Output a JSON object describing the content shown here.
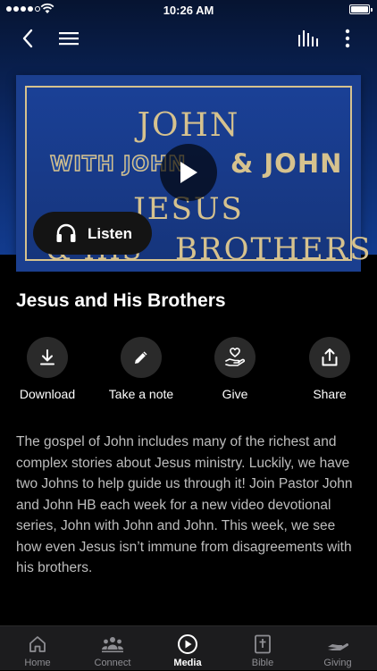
{
  "status_bar": {
    "time": "10:26 AM",
    "signal_icon": "signal-dots-icon",
    "wifi_icon": "wifi-icon",
    "battery_icon": "battery-full-icon"
  },
  "nav": {
    "back_icon": "chevron-left-icon",
    "menu_icon": "hamburger-menu-icon",
    "bars_icon": "equalizer-bars-icon",
    "more_icon": "more-vertical-icon"
  },
  "artwork": {
    "line1": "JOHN",
    "line2a": "WITH JOHN",
    "line2b": "& JOHN",
    "line3": "JESUS",
    "line4a": "& HIS",
    "line4b": "BROTHERS",
    "colors": {
      "gold": "#d6c28e",
      "blue": "#1a4096"
    }
  },
  "listen_button": {
    "label": "Listen",
    "icon": "headphones-icon"
  },
  "play_button": {
    "icon": "play-icon"
  },
  "media_title": "Jesus and His Brothers",
  "actions": [
    {
      "label": "Download",
      "icon": "download-icon"
    },
    {
      "label": "Take a note",
      "icon": "pencil-icon"
    },
    {
      "label": "Give",
      "icon": "hand-heart-icon"
    },
    {
      "label": "Share",
      "icon": "share-icon"
    }
  ],
  "description": "The gospel of John includes many of the richest and complex stories about Jesus ministry. Luckily, we have two Johns to help guide us through it! Join Pastor John and John HB each week for a new video devotional series, John with John and John. This week, we see how even Jesus isn’t immune from disagreements with his brothers.",
  "tabs": [
    {
      "label": "Home",
      "icon": "home-icon",
      "active": false
    },
    {
      "label": "Connect",
      "icon": "people-icon",
      "active": false
    },
    {
      "label": "Media",
      "icon": "play-circle-icon",
      "active": true
    },
    {
      "label": "Bible",
      "icon": "bible-icon",
      "active": false
    },
    {
      "label": "Giving",
      "icon": "giving-hand-icon",
      "active": false
    }
  ]
}
